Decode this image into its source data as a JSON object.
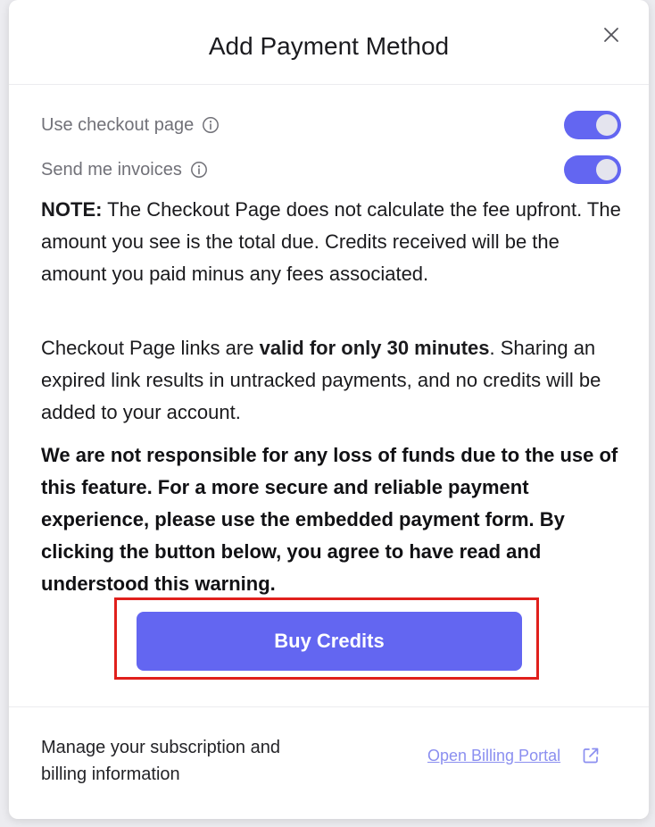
{
  "modal": {
    "title": "Add Payment Method",
    "close_icon": "close-icon"
  },
  "toggles": [
    {
      "label": "Use checkout page",
      "enabled": true,
      "icon": "info-icon"
    },
    {
      "label": "Send me invoices",
      "enabled": true,
      "icon": "info-icon"
    }
  ],
  "note": {
    "prefix": "NOTE:",
    "text": " The Checkout Page does not calculate the fee upfront. The amount you see is the total due. Credits received will be the amount you paid minus any fees associated."
  },
  "links_info": {
    "part1": "Checkout Page links are ",
    "bold": "valid for only 30 minutes",
    "part2": ". Sharing an expired link results in untracked payments, and no credits will be added to your account."
  },
  "warning": "We are not responsible for any loss of funds due to the use of this feature. For a more secure and reliable payment experience, please use the embedded payment form. By clicking the button below, you agree to have read and understood this warning.",
  "buy_button": {
    "label": "Buy Credits"
  },
  "footer": {
    "text": "Manage your subscription and billing information",
    "link_label": "Open Billing Portal",
    "link_icon": "external-link-icon"
  },
  "colors": {
    "accent": "#6366f1",
    "highlight": "#e0201c",
    "link": "#8b8ff0"
  }
}
